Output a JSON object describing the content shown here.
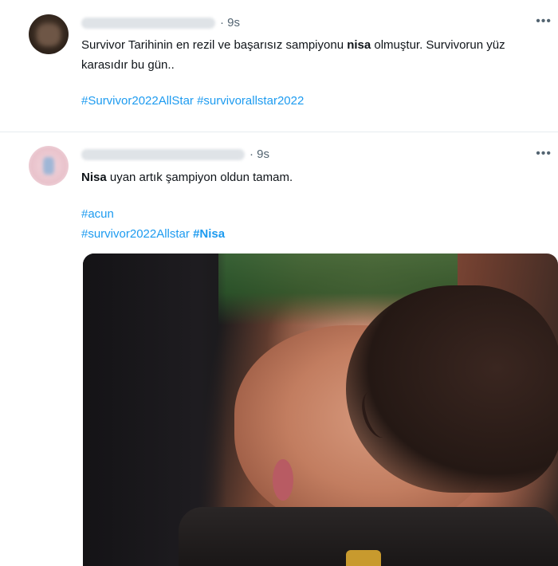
{
  "tweets": [
    {
      "timestamp": "· 9s",
      "more_icon": "more-horizontal-icon",
      "body_parts": [
        "Survivor Tarihinin en rezil ve başarısız sampiyonu ",
        "nisa",
        " olmuştur. Survivorun yüz karasıdır bu gün.."
      ],
      "hashtags": [
        "#Survivor2022AllStar",
        "#survivorallstar2022"
      ]
    },
    {
      "timestamp": "· 9s",
      "more_icon": "more-horizontal-icon",
      "body_parts": [
        "Nisa",
        " uyan artık şampiyon oldun tamam."
      ],
      "hashtags_line1": [
        "#acun"
      ],
      "hashtags_line2": [
        "#survivor2022Allstar",
        "#Nisa"
      ]
    }
  ],
  "colors": {
    "link": "#1d9bf0",
    "text": "#0f1419",
    "muted": "#536471"
  }
}
